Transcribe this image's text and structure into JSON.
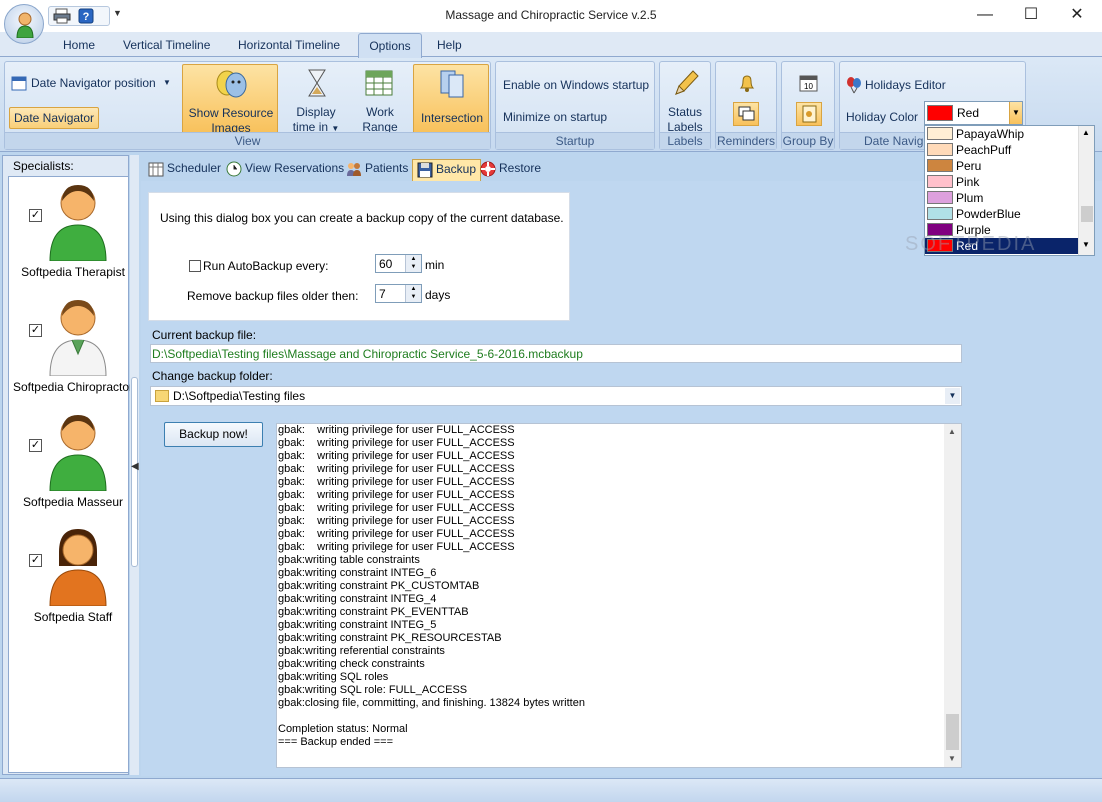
{
  "window": {
    "title": "Massage and Chiropractic Service v.2.5",
    "minimize_glyph": "—",
    "maximize_glyph": "☐",
    "close_glyph": "✕",
    "qat_more_glyph": "▼"
  },
  "ribbon_tabs": [
    "Home",
    "Vertical Timeline",
    "Horizontal Timeline",
    "Options",
    "Help"
  ],
  "ribbon": {
    "groups": {
      "view": {
        "label": "View",
        "date_nav_position": "Date Navigator position",
        "date_navigator": "Date Navigator",
        "show_resource_images_1": "Show Resource",
        "show_resource_images_2": "Images",
        "display_time_in_1": "Display",
        "display_time_in_2": "time in",
        "work_range_1": "Work",
        "work_range_2": "Range",
        "intersection": "Intersection"
      },
      "startup": {
        "label": "Startup",
        "enable_windows_startup": "Enable on Windows startup",
        "minimize_on_startup": "Minimize on startup"
      },
      "labels": {
        "label": "Labels",
        "status_labels_1": "Status",
        "status_labels_2": "Labels"
      },
      "reminders": {
        "label": "Reminders"
      },
      "group_by": {
        "label": "Group By",
        "calendar_number": "10"
      },
      "date_navigator": {
        "label": "Date Navig",
        "holidays_editor": "Holidays Editor",
        "holiday_color_label": "Holiday Color",
        "holiday_color_value": "Red"
      }
    }
  },
  "color_list": [
    {
      "name": "PapayaWhip",
      "color": "#ffefd5"
    },
    {
      "name": "PeachPuff",
      "color": "#ffdab9"
    },
    {
      "name": "Peru",
      "color": "#cd853f"
    },
    {
      "name": "Pink",
      "color": "#ffc0cb"
    },
    {
      "name": "Plum",
      "color": "#dda0dd"
    },
    {
      "name": "PowderBlue",
      "color": "#b0e0e6"
    },
    {
      "name": "Purple",
      "color": "#800080"
    },
    {
      "name": "Red",
      "color": "#ff0000",
      "selected": true
    }
  ],
  "sidebar": {
    "title": "Specialists:",
    "collapse_glyph": "◀",
    "items": [
      {
        "name": "Softpedia Therapist",
        "checked": true
      },
      {
        "name": "Softpedia Chiropractor",
        "checked": true
      },
      {
        "name": "Softpedia Masseur",
        "checked": true
      },
      {
        "name": "Softpedia Staff",
        "checked": true
      }
    ],
    "check_glyph": "✓"
  },
  "main_tabs": [
    "Scheduler",
    "View Reservations",
    "Patients",
    "Backup",
    "Restore"
  ],
  "backup": {
    "description": "Using this dialog box you can create a backup copy of the current database.",
    "auto_backup_label": "Run AutoBackup every:",
    "auto_backup_checked": false,
    "auto_backup_value": "60",
    "auto_backup_unit": "min",
    "remove_label": "Remove backup files older then:",
    "remove_value": "7",
    "remove_unit": "days",
    "current_file_label": "Current backup file:",
    "current_file": "D:\\Softpedia\\Testing files\\Massage and Chiropractic Service_5-6-2016.mcbackup",
    "change_folder_label": "Change backup folder:",
    "folder": "D:\\Softpedia\\Testing files",
    "backup_now": "Backup now!",
    "spin_arrows": "▲\n▼"
  },
  "log_lines": [
    "gbak:    writing privilege for user FULL_ACCESS",
    "gbak:    writing privilege for user FULL_ACCESS",
    "gbak:    writing privilege for user FULL_ACCESS",
    "gbak:    writing privilege for user FULL_ACCESS",
    "gbak:    writing privilege for user FULL_ACCESS",
    "gbak:    writing privilege for user FULL_ACCESS",
    "gbak:    writing privilege for user FULL_ACCESS",
    "gbak:    writing privilege for user FULL_ACCESS",
    "gbak:    writing privilege for user FULL_ACCESS",
    "gbak:    writing privilege for user FULL_ACCESS",
    "gbak:writing table constraints",
    "gbak:writing constraint INTEG_6",
    "gbak:writing constraint PK_CUSTOMTAB",
    "gbak:writing constraint INTEG_4",
    "gbak:writing constraint PK_EVENTTAB",
    "gbak:writing constraint INTEG_5",
    "gbak:writing constraint PK_RESOURCESTAB",
    "gbak:writing referential constraints",
    "gbak:writing check constraints",
    "gbak:writing SQL roles",
    "gbak:writing SQL role: FULL_ACCESS",
    "gbak:closing file, committing, and finishing. 13824 bytes written",
    "",
    "Completion status: Normal",
    "=== Backup ended ==="
  ],
  "watermark": "SOFTPEDIA"
}
